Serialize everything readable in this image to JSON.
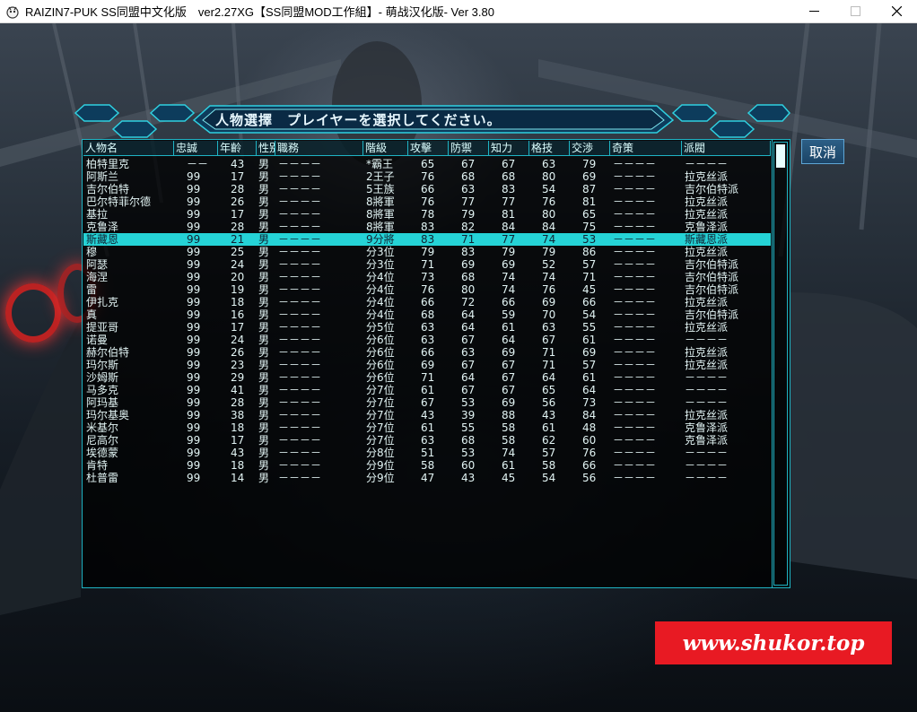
{
  "window": {
    "title": "RAIZIN7-PUK SS同盟中文化版　ver2.27XG【SS同盟MOD工作組】- 萌战汉化版- Ver 3.80"
  },
  "dialog": {
    "title": "人物選擇　プレイヤーを選択してください。",
    "cancel_label": "取消"
  },
  "columns": [
    "人物名",
    "忠誠",
    "年齡",
    "性别",
    "職務",
    "階級",
    "攻擊",
    "防禦",
    "知力",
    "格技",
    "交渉",
    "奇策",
    "派閥"
  ],
  "rows": [
    {
      "name": "柏特里克",
      "loyalty": "－－",
      "age": "43",
      "sex": "男",
      "duty": "－－－－",
      "rank": "*霸王",
      "atk": "65",
      "def": "67",
      "int": "67",
      "cmb": "63",
      "neg": "79",
      "strat": "－－－－",
      "faction": "－－－－"
    },
    {
      "name": "阿斯兰",
      "loyalty": "99",
      "age": "17",
      "sex": "男",
      "duty": "－－－－",
      "rank": "2王子",
      "atk": "76",
      "def": "68",
      "int": "68",
      "cmb": "80",
      "neg": "69",
      "strat": "－－－－",
      "faction": "拉克丝派"
    },
    {
      "name": "吉尔伯特",
      "loyalty": "99",
      "age": "28",
      "sex": "男",
      "duty": "－－－－",
      "rank": "5王族",
      "atk": "66",
      "def": "63",
      "int": "83",
      "cmb": "54",
      "neg": "87",
      "strat": "－－－－",
      "faction": "吉尔伯特派"
    },
    {
      "name": "巴尔特菲尔德",
      "loyalty": "99",
      "age": "26",
      "sex": "男",
      "duty": "－－－－",
      "rank": "8將軍",
      "atk": "76",
      "def": "77",
      "int": "77",
      "cmb": "76",
      "neg": "81",
      "strat": "－－－－",
      "faction": "拉克丝派"
    },
    {
      "name": "基拉",
      "loyalty": "99",
      "age": "17",
      "sex": "男",
      "duty": "－－－－",
      "rank": "8將軍",
      "atk": "78",
      "def": "79",
      "int": "81",
      "cmb": "80",
      "neg": "65",
      "strat": "－－－－",
      "faction": "拉克丝派"
    },
    {
      "name": "克鲁泽",
      "loyalty": "99",
      "age": "28",
      "sex": "男",
      "duty": "－－－－",
      "rank": "8將軍",
      "atk": "83",
      "def": "82",
      "int": "84",
      "cmb": "84",
      "neg": "75",
      "strat": "－－－－",
      "faction": "克鲁泽派"
    },
    {
      "name": "斯藏恩",
      "loyalty": "99",
      "age": "21",
      "sex": "男",
      "duty": "－－－－",
      "rank": "9分將",
      "atk": "83",
      "def": "71",
      "int": "77",
      "cmb": "74",
      "neg": "53",
      "strat": "－－－－",
      "faction": "斯藏恩派",
      "selected": true
    },
    {
      "name": "穆",
      "loyalty": "99",
      "age": "25",
      "sex": "男",
      "duty": "－－－－",
      "rank": "分3位",
      "atk": "79",
      "def": "83",
      "int": "79",
      "cmb": "79",
      "neg": "86",
      "strat": "－－－－",
      "faction": "拉克丝派"
    },
    {
      "name": "阿瑟",
      "loyalty": "99",
      "age": "24",
      "sex": "男",
      "duty": "－－－－",
      "rank": "分3位",
      "atk": "71",
      "def": "69",
      "int": "69",
      "cmb": "52",
      "neg": "57",
      "strat": "－－－－",
      "faction": "吉尔伯特派"
    },
    {
      "name": "海涅",
      "loyalty": "99",
      "age": "20",
      "sex": "男",
      "duty": "－－－－",
      "rank": "分4位",
      "atk": "73",
      "def": "68",
      "int": "74",
      "cmb": "74",
      "neg": "71",
      "strat": "－－－－",
      "faction": "吉尔伯特派"
    },
    {
      "name": "雷",
      "loyalty": "99",
      "age": "19",
      "sex": "男",
      "duty": "－－－－",
      "rank": "分4位",
      "atk": "76",
      "def": "80",
      "int": "74",
      "cmb": "76",
      "neg": "45",
      "strat": "－－－－",
      "faction": "吉尔伯特派"
    },
    {
      "name": "伊扎克",
      "loyalty": "99",
      "age": "18",
      "sex": "男",
      "duty": "－－－－",
      "rank": "分4位",
      "atk": "66",
      "def": "72",
      "int": "66",
      "cmb": "69",
      "neg": "66",
      "strat": "－－－－",
      "faction": "拉克丝派"
    },
    {
      "name": "真",
      "loyalty": "99",
      "age": "16",
      "sex": "男",
      "duty": "－－－－",
      "rank": "分4位",
      "atk": "68",
      "def": "64",
      "int": "59",
      "cmb": "70",
      "neg": "54",
      "strat": "－－－－",
      "faction": "吉尔伯特派"
    },
    {
      "name": "提亚哥",
      "loyalty": "99",
      "age": "17",
      "sex": "男",
      "duty": "－－－－",
      "rank": "分5位",
      "atk": "63",
      "def": "64",
      "int": "61",
      "cmb": "63",
      "neg": "55",
      "strat": "－－－－",
      "faction": "拉克丝派"
    },
    {
      "name": "诺曼",
      "loyalty": "99",
      "age": "24",
      "sex": "男",
      "duty": "－－－－",
      "rank": "分6位",
      "atk": "63",
      "def": "67",
      "int": "64",
      "cmb": "67",
      "neg": "61",
      "strat": "－－－－",
      "faction": "－－－－"
    },
    {
      "name": "赫尔伯特",
      "loyalty": "99",
      "age": "26",
      "sex": "男",
      "duty": "－－－－",
      "rank": "分6位",
      "atk": "66",
      "def": "63",
      "int": "69",
      "cmb": "71",
      "neg": "69",
      "strat": "－－－－",
      "faction": "拉克丝派"
    },
    {
      "name": "玛尔斯",
      "loyalty": "99",
      "age": "23",
      "sex": "男",
      "duty": "－－－－",
      "rank": "分6位",
      "atk": "69",
      "def": "67",
      "int": "67",
      "cmb": "71",
      "neg": "57",
      "strat": "－－－－",
      "faction": "拉克丝派"
    },
    {
      "name": "沙姆斯",
      "loyalty": "99",
      "age": "29",
      "sex": "男",
      "duty": "－－－－",
      "rank": "分6位",
      "atk": "71",
      "def": "64",
      "int": "67",
      "cmb": "64",
      "neg": "61",
      "strat": "－－－－",
      "faction": "－－－－"
    },
    {
      "name": "马多克",
      "loyalty": "99",
      "age": "41",
      "sex": "男",
      "duty": "－－－－",
      "rank": "分7位",
      "atk": "61",
      "def": "67",
      "int": "67",
      "cmb": "65",
      "neg": "64",
      "strat": "－－－－",
      "faction": "－－－－"
    },
    {
      "name": "阿玛基",
      "loyalty": "99",
      "age": "28",
      "sex": "男",
      "duty": "－－－－",
      "rank": "分7位",
      "atk": "67",
      "def": "53",
      "int": "69",
      "cmb": "56",
      "neg": "73",
      "strat": "－－－－",
      "faction": "－－－－"
    },
    {
      "name": "玛尔基奥",
      "loyalty": "99",
      "age": "38",
      "sex": "男",
      "duty": "－－－－",
      "rank": "分7位",
      "atk": "43",
      "def": "39",
      "int": "88",
      "cmb": "43",
      "neg": "84",
      "strat": "－－－－",
      "faction": "拉克丝派"
    },
    {
      "name": "米基尔",
      "loyalty": "99",
      "age": "18",
      "sex": "男",
      "duty": "－－－－",
      "rank": "分7位",
      "atk": "61",
      "def": "55",
      "int": "58",
      "cmb": "61",
      "neg": "48",
      "strat": "－－－－",
      "faction": "克鲁泽派"
    },
    {
      "name": "尼高尔",
      "loyalty": "99",
      "age": "17",
      "sex": "男",
      "duty": "－－－－",
      "rank": "分7位",
      "atk": "63",
      "def": "68",
      "int": "58",
      "cmb": "62",
      "neg": "60",
      "strat": "－－－－",
      "faction": "克鲁泽派"
    },
    {
      "name": "埃德蒙",
      "loyalty": "99",
      "age": "43",
      "sex": "男",
      "duty": "－－－－",
      "rank": "分8位",
      "atk": "51",
      "def": "53",
      "int": "74",
      "cmb": "57",
      "neg": "76",
      "strat": "－－－－",
      "faction": "－－－－"
    },
    {
      "name": "肯特",
      "loyalty": "99",
      "age": "18",
      "sex": "男",
      "duty": "－－－－",
      "rank": "分9位",
      "atk": "58",
      "def": "60",
      "int": "61",
      "cmb": "58",
      "neg": "66",
      "strat": "－－－－",
      "faction": "－－－－"
    },
    {
      "name": "杜普雷",
      "loyalty": "99",
      "age": "14",
      "sex": "男",
      "duty": "－－－－",
      "rank": "分9位",
      "atk": "47",
      "def": "43",
      "int": "45",
      "cmb": "54",
      "neg": "56",
      "strat": "－－－－",
      "faction": "－－－－"
    }
  ],
  "watermark": "www.shukor.top",
  "colors": {
    "accent": "#1fb4c4",
    "selected_row": "#25d3d6",
    "watermark_bg": "#e81a23"
  }
}
